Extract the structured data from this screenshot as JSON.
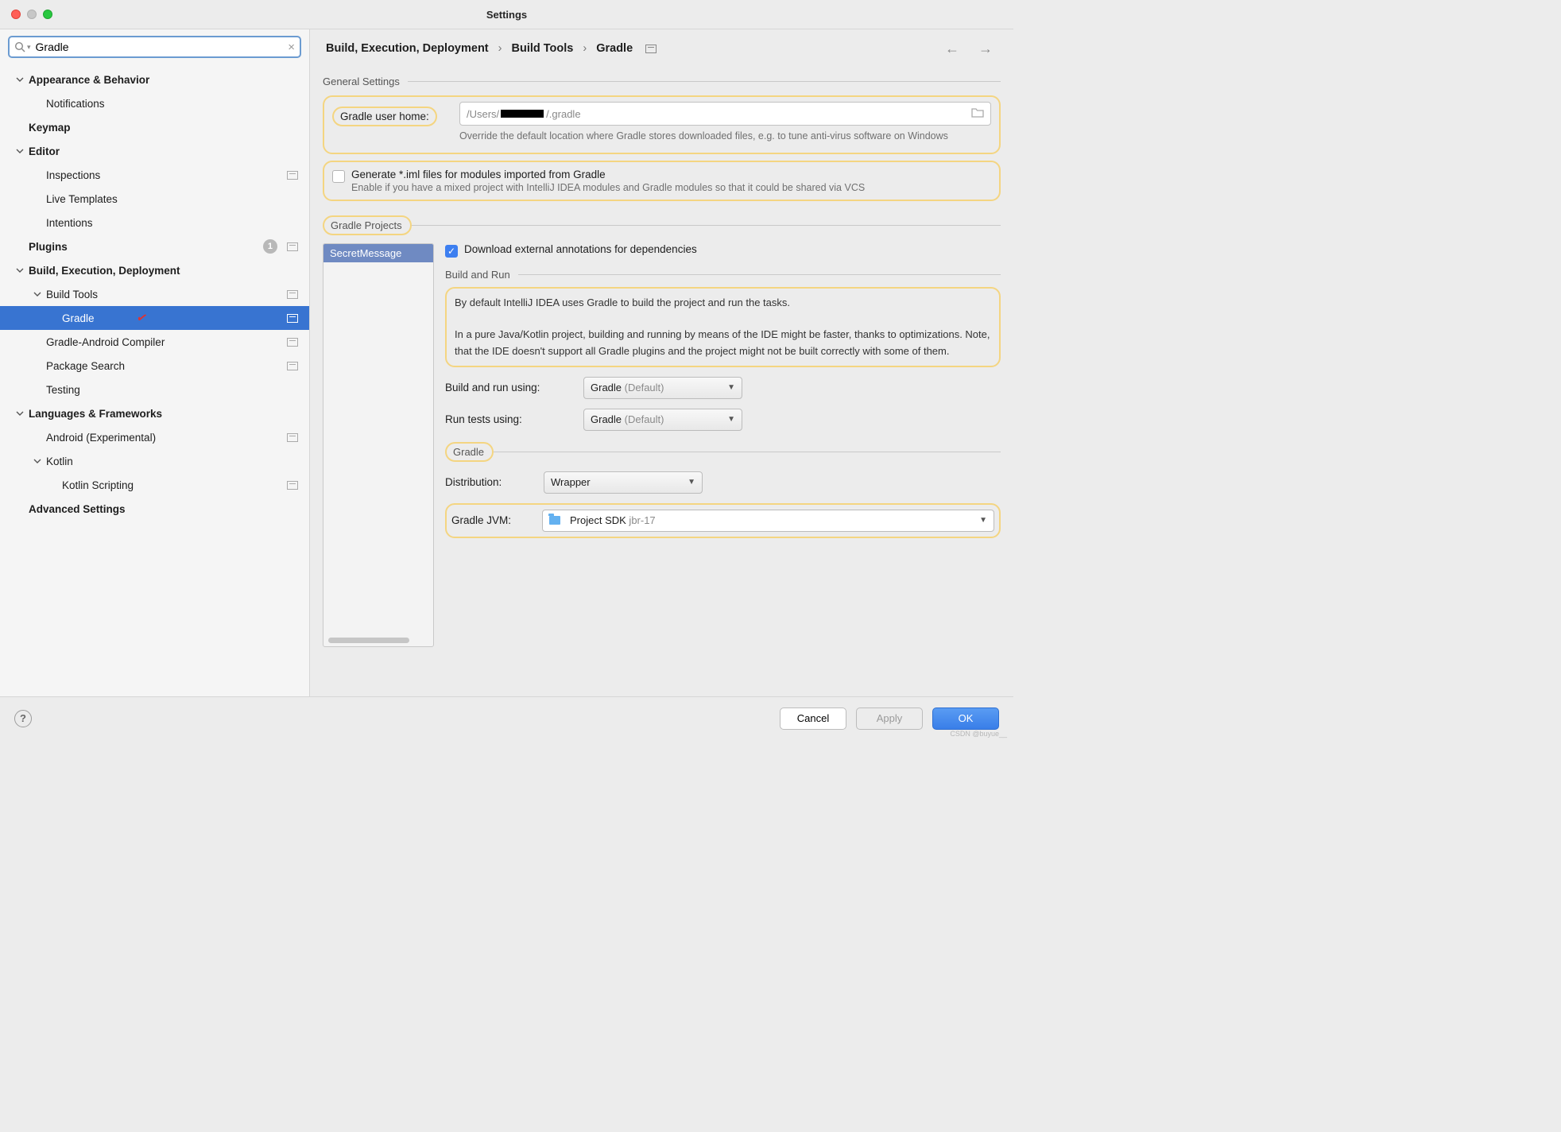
{
  "window": {
    "title": "Settings"
  },
  "search": {
    "value": "Gradle"
  },
  "tree": {
    "appearance": "Appearance & Behavior",
    "notifications": "Notifications",
    "keymap": "Keymap",
    "editor": "Editor",
    "inspections": "Inspections",
    "live_templates": "Live Templates",
    "intentions": "Intentions",
    "plugins": "Plugins",
    "plugins_badge": "1",
    "build": "Build, Execution, Deployment",
    "build_tools": "Build Tools",
    "gradle": "Gradle",
    "gradle_android": "Gradle-Android Compiler",
    "package_search": "Package Search",
    "testing": "Testing",
    "languages": "Languages & Frameworks",
    "android": "Android (Experimental)",
    "kotlin": "Kotlin",
    "kotlin_scripting": "Kotlin Scripting",
    "advanced": "Advanced Settings"
  },
  "breadcrumb": {
    "a": "Build, Execution, Deployment",
    "b": "Build Tools",
    "c": "Gradle"
  },
  "general": {
    "header": "General Settings",
    "user_home_label": "Gradle user home:",
    "user_home_prefix": "/Users/",
    "user_home_suffix": ".gradle",
    "user_home_hint": "Override the default location where Gradle stores downloaded files, e.g. to tune anti-virus software on Windows",
    "iml_label": "Generate *.iml files for modules imported from Gradle",
    "iml_hint": "Enable if you have a mixed project with IntelliJ IDEA modules and Gradle modules so that it could be shared via VCS"
  },
  "projects": {
    "header": "Gradle Projects",
    "item": "SecretMessage",
    "download_label": "Download external annotations for dependencies",
    "build_run_header": "Build and Run",
    "info1": "By default IntelliJ IDEA uses Gradle to build the project and run the tasks.",
    "info2": "In a pure Java/Kotlin project, building and running by means of the IDE might be faster, thanks to optimizations. Note, that the IDE doesn't support all Gradle plugins and the project might not be built correctly with some of them.",
    "build_using_label": "Build and run using:",
    "build_using_value": "Gradle",
    "build_using_default": " (Default)",
    "tests_using_label": "Run tests using:",
    "tests_using_value": "Gradle",
    "tests_using_default": " (Default)",
    "gradle_header": "Gradle",
    "distribution_label": "Distribution:",
    "distribution_value": "Wrapper",
    "jvm_label": "Gradle JVM:",
    "jvm_value": "Project SDK",
    "jvm_secondary": " jbr-17"
  },
  "footer": {
    "cancel": "Cancel",
    "apply": "Apply",
    "ok": "OK"
  },
  "watermark": "CSDN @buyue__"
}
